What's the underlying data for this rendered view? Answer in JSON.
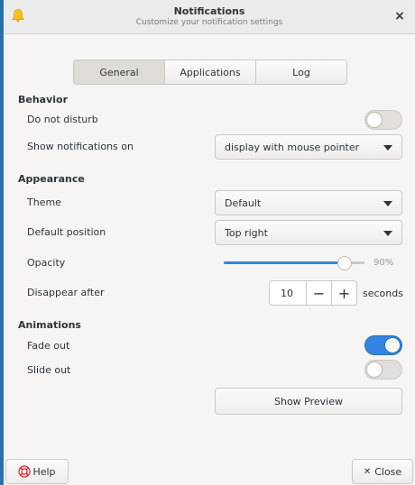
{
  "header": {
    "title": "Notifications",
    "subtitle": "Customize your notification settings",
    "close_glyph": "×",
    "bell_icon": "bell-icon",
    "accent_color": "#f5c211"
  },
  "tabs": [
    {
      "label": "General",
      "active": true
    },
    {
      "label": "Applications",
      "active": false
    },
    {
      "label": "Log",
      "active": false
    }
  ],
  "behavior": {
    "title": "Behavior",
    "do_not_disturb": {
      "label": "Do not disturb",
      "on": false
    },
    "show_on": {
      "label": "Show notifications on",
      "value": "display with mouse pointer"
    }
  },
  "appearance": {
    "title": "Appearance",
    "theme": {
      "label": "Theme",
      "value": "Default"
    },
    "position": {
      "label": "Default position",
      "value": "Top right"
    },
    "opacity": {
      "label": "Opacity",
      "value_text": "90%",
      "value": 0.9
    },
    "disappear": {
      "label": "Disappear after",
      "value": "10",
      "minus": "−",
      "plus": "+",
      "unit": "seconds"
    }
  },
  "animations": {
    "title": "Animations",
    "fade_out": {
      "label": "Fade out",
      "on": true
    },
    "slide_out": {
      "label": "Slide out",
      "on": false
    }
  },
  "preview_button": "Show Preview",
  "footer": {
    "help_label": "Help",
    "close_label": "Close",
    "close_glyph": "✕"
  },
  "colors": {
    "switch_on": "#3584e4",
    "window_bg": "#f6f5f4"
  }
}
